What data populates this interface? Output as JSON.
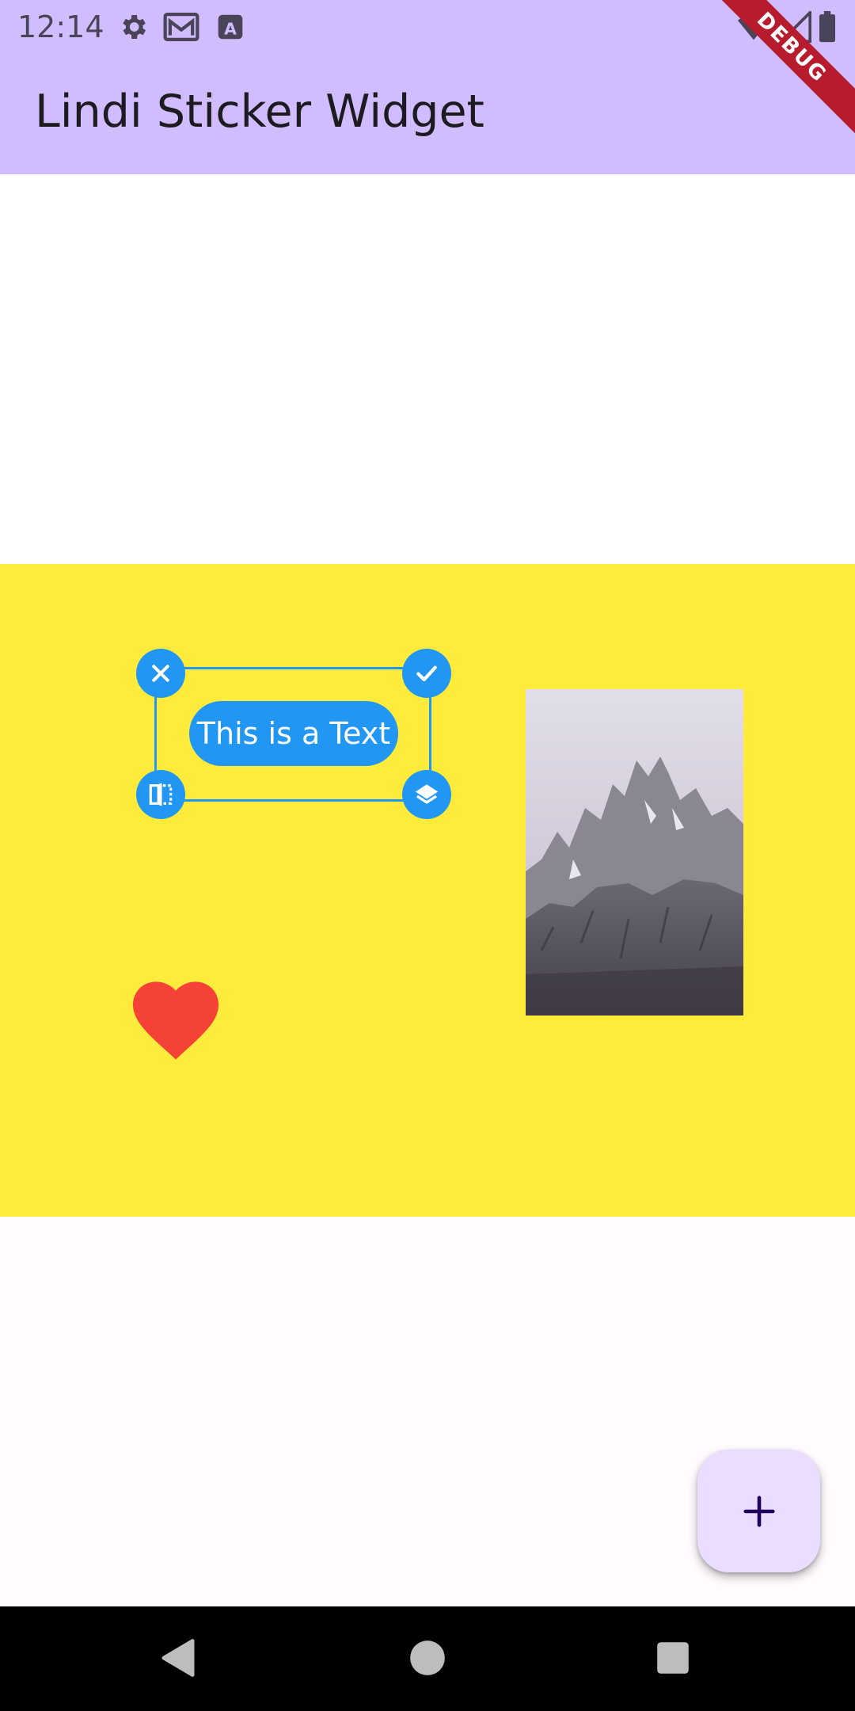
{
  "status_bar": {
    "time": "12:14",
    "icons": [
      "settings-icon",
      "gmail-icon",
      "font-a-icon",
      "wifi-icon",
      "signal-icon",
      "battery-icon"
    ]
  },
  "app_bar": {
    "title": "Lindi Sticker Widget",
    "debug_label": "DEBUG",
    "color": "#d1bcff"
  },
  "canvas": {
    "background": "#ffeb3b",
    "text_sticker": {
      "label": "This is a Text",
      "color": "#2196f3"
    },
    "selection_handles": [
      "close-icon",
      "check-icon",
      "flip-icon",
      "layers-icon"
    ],
    "heart_sticker": {
      "icon": "heart-icon",
      "color": "#f44336"
    },
    "image_sticker": {
      "subject": "mountain photo"
    }
  },
  "fab": {
    "icon": "add-icon",
    "label": "+"
  },
  "nav_bar": {
    "buttons": [
      "back-icon",
      "home-icon",
      "recents-icon"
    ]
  }
}
